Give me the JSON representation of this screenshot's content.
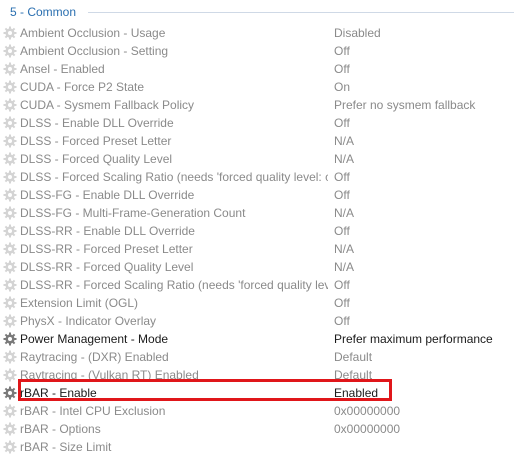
{
  "section": {
    "title": "5 - Common"
  },
  "settings": [
    {
      "name": "Ambient Occlusion  - Usage",
      "value": "Disabled",
      "active": false
    },
    {
      "name": "Ambient Occlusion  - Setting",
      "value": "Off",
      "active": false
    },
    {
      "name": "Ansel - Enabled",
      "value": "Off",
      "active": false
    },
    {
      "name": "CUDA - Force P2 State",
      "value": "On",
      "active": false
    },
    {
      "name": "CUDA - Sysmem Fallback Policy",
      "value": "Prefer no sysmem fallback",
      "active": false
    },
    {
      "name": "DLSS - Enable DLL Override",
      "value": "Off",
      "active": false
    },
    {
      "name": "DLSS - Forced Preset Letter",
      "value": "N/A",
      "active": false
    },
    {
      "name": "DLSS - Forced Quality Level",
      "value": "N/A",
      "active": false
    },
    {
      "name": "DLSS - Forced Scaling Ratio (needs 'forced quality level: custo...",
      "value": "Off",
      "active": false
    },
    {
      "name": "DLSS-FG - Enable DLL Override",
      "value": "Off",
      "active": false
    },
    {
      "name": "DLSS-FG - Multi-Frame-Generation Count",
      "value": "N/A",
      "active": false
    },
    {
      "name": "DLSS-RR - Enable DLL Override",
      "value": "Off",
      "active": false
    },
    {
      "name": "DLSS-RR - Forced Preset Letter",
      "value": "N/A",
      "active": false
    },
    {
      "name": "DLSS-RR - Forced Quality Level",
      "value": "N/A",
      "active": false
    },
    {
      "name": "DLSS-RR - Forced Scaling Ratio (needs 'forced quality level: c...",
      "value": "Off",
      "active": false
    },
    {
      "name": "Extension Limit (OGL)",
      "value": "Off",
      "active": false
    },
    {
      "name": "PhysX - Indicator Overlay",
      "value": "Off",
      "active": false
    },
    {
      "name": "Power Management - Mode",
      "value": "Prefer maximum performance",
      "active": true
    },
    {
      "name": "Raytracing - (DXR) Enabled",
      "value": "Default",
      "active": false
    },
    {
      "name": "Raytracing - (Vulkan RT) Enabled",
      "value": "Default",
      "active": false
    },
    {
      "name": "rBAR - Enable",
      "value": "Enabled",
      "active": true
    },
    {
      "name": "rBAR - Intel CPU Exclusion",
      "value": "0x00000000",
      "active": false
    },
    {
      "name": "rBAR - Options",
      "value": "0x00000000",
      "active": false
    },
    {
      "name": "rBAR - Size Limit",
      "value": "",
      "active": false
    }
  ],
  "icons": {
    "inactive": "gear-icon-faded",
    "active": "gear-icon"
  },
  "colors": {
    "inactive_text": "#8a8a8a",
    "active_text": "#1a1a1a",
    "section_title": "#2a6fb0",
    "highlight_border": "#e0161a"
  }
}
